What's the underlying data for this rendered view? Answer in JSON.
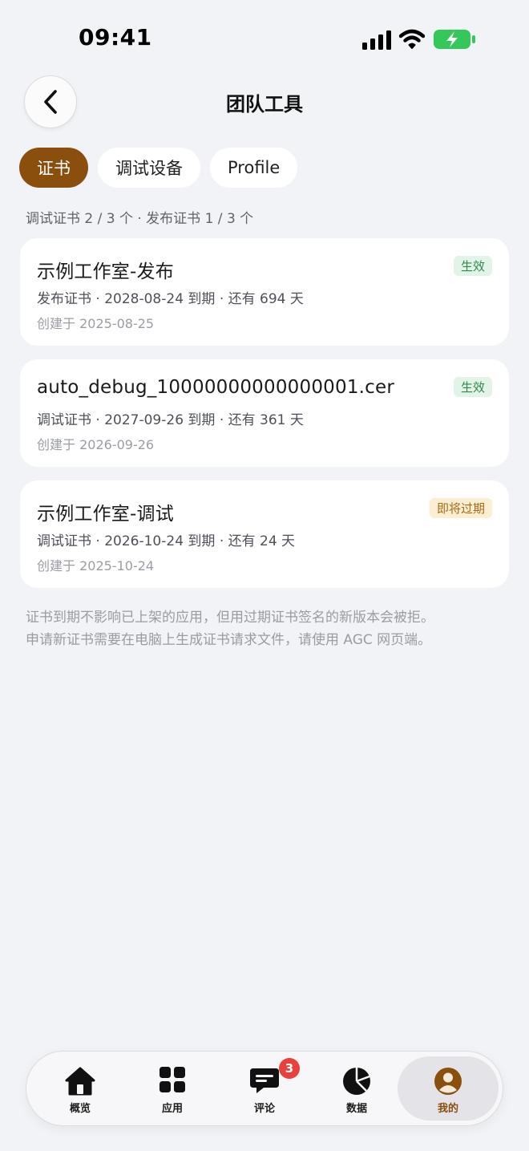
{
  "status": {
    "time": "09:41"
  },
  "header": {
    "title": "团队工具"
  },
  "tabs": [
    {
      "label": "证书",
      "active": true
    },
    {
      "label": "调试设备",
      "active": false
    },
    {
      "label": "Profile",
      "active": false
    }
  ],
  "summary": "调试证书 2 / 3 个 · 发布证书 1 / 3 个",
  "certificates": [
    {
      "name": "示例工作室-发布",
      "meta": "发布证书 · 2028-08-24 到期 · 还有 694 天",
      "created": "创建于 2025-08-25",
      "status": "生效",
      "status_type": "ok"
    },
    {
      "name": "auto_debug_10000000000000001.cer",
      "meta": "调试证书 · 2027-09-26 到期 · 还有 361 天",
      "created": "创建于 2026-09-26",
      "status": "生效",
      "status_type": "ok"
    },
    {
      "name": "示例工作室-调试",
      "meta": "调试证书 · 2026-10-24 到期 · 还有 24 天",
      "created": "创建于 2025-10-24",
      "status": "即将过期",
      "status_type": "warn"
    }
  ],
  "footnote": {
    "line1": "证书到期不影响已上架的应用，但用过期证书签名的新版本会被拒。",
    "line2": "申请新证书需要在电脑上生成证书请求文件，请使用 AGC 网页端。"
  },
  "nav": {
    "items": [
      {
        "label": "概览",
        "icon": "home-icon"
      },
      {
        "label": "应用",
        "icon": "grid-icon"
      },
      {
        "label": "评论",
        "icon": "comment-icon",
        "badge": "3"
      },
      {
        "label": "数据",
        "icon": "pie-chart-icon"
      },
      {
        "label": "我的",
        "icon": "profile-icon",
        "active": true
      }
    ]
  },
  "colors": {
    "accent": "#8a4f0c",
    "background": "#f2f3f6",
    "ok": "#2f8a4a",
    "warn": "#a56a12",
    "badge": "#e8413d"
  }
}
